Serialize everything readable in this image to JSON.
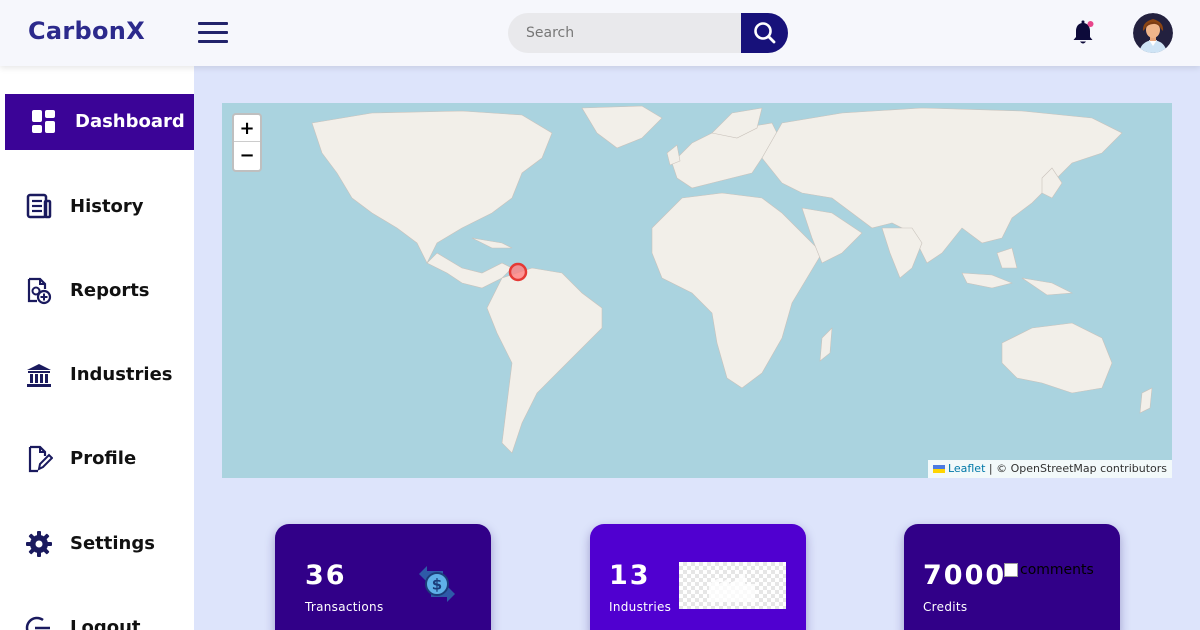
{
  "header": {
    "brand": "CarbonX",
    "search_placeholder": "Search"
  },
  "sidebar": {
    "items": [
      {
        "label": "Dashboard",
        "icon": "dashboard-icon",
        "active": true
      },
      {
        "label": "History",
        "icon": "history-icon"
      },
      {
        "label": "Reports",
        "icon": "reports-icon"
      },
      {
        "label": "Industries",
        "icon": "industries-icon"
      },
      {
        "label": "Profile",
        "icon": "profile-icon"
      },
      {
        "label": "Settings",
        "icon": "gear-icon"
      },
      {
        "label": "Logout",
        "icon": "logout-icon"
      }
    ]
  },
  "map": {
    "zoom_in": "+",
    "zoom_out": "−",
    "attribution_link": "Leaflet",
    "attribution_text": "| © OpenStreetMap contributors",
    "marker_color": "#e53935"
  },
  "cards": [
    {
      "value": "36",
      "label": "Transactions",
      "icon": "exchange-dollar-icon"
    },
    {
      "value": "13",
      "label": "Industries",
      "icon": "industries-image"
    },
    {
      "value": "7000",
      "label": "Credits",
      "image_alt": "comments"
    }
  ],
  "colors": {
    "brand": "#2c2a8c",
    "accent": "#3b0497",
    "card_dark": "#310088",
    "card_bright": "#5000d0",
    "background": "#dde4fb"
  }
}
